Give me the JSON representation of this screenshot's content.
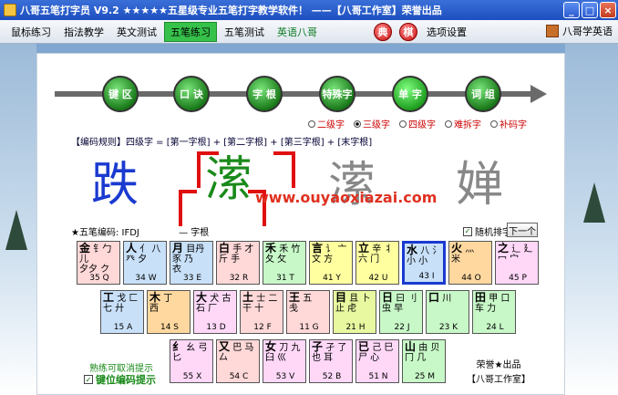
{
  "window": {
    "title": "八哥五笔打字员 V9.2  ★★★★★五星级专业五笔打字教学软件！ ——【八哥工作室】荣誉出品",
    "min": "_",
    "max": "□",
    "close": "×"
  },
  "menu": {
    "items": [
      "鼠标练习",
      "指法教学",
      "英文测试",
      "五笔练习",
      "五笔测试",
      "英语八哥"
    ],
    "round1": "典",
    "round2": "棋",
    "settings": "选项设置",
    "right": "八哥学英语"
  },
  "nav": [
    "键 区",
    "口 诀",
    "字 根",
    "特殊字",
    "单 字",
    "词 组"
  ],
  "radios": [
    "二级字",
    "三级字",
    "四级字",
    "难拆字",
    "补码字"
  ],
  "rule": "【编码规则】四级字 = [第一字根] + [第二字根] + [第三字根] + [末字根]",
  "chars": [
    "跌",
    "潆",
    "潆",
    "婵"
  ],
  "watermark": "www.ouyaoxiazai.com",
  "code_line": "★五笔编码: IFDJ",
  "code_mid": "— 字根",
  "random_label": "随机排字",
  "next_label": "下一个",
  "keys_row1": [
    {
      "main": "金",
      "roots": "钅勹 儿\n夕夕 ク",
      "code": "35 Q"
    },
    {
      "main": "人",
      "roots": "亻 八\n癶 夕",
      "code": "34 W"
    },
    {
      "main": "月",
      "roots": "目丹\n豕 乃\n衣",
      "code": "33 E"
    },
    {
      "main": "白",
      "roots": "手 才\n斤 手",
      "code": "32 R"
    },
    {
      "main": "禾",
      "roots": "禾 竹\n夂 攵",
      "code": "31 T"
    },
    {
      "main": "言",
      "roots": "讠 亠\n文 方",
      "code": "41 Y"
    },
    {
      "main": "立",
      "roots": "辛 丬\n六 门",
      "code": "42 U"
    },
    {
      "main": "水",
      "roots": "八 氵\n小 小",
      "code": "43 I"
    },
    {
      "main": "火",
      "roots": "灬\n米",
      "code": "44 O"
    },
    {
      "main": "之",
      "roots": "辶 廴\n冖 宀",
      "code": "45 P"
    }
  ],
  "keys_row2": [
    {
      "main": "工",
      "roots": "戈 匚\n七 廾",
      "code": "15 A"
    },
    {
      "main": "木",
      "roots": "丁\n西",
      "code": "14 S"
    },
    {
      "main": "大",
      "roots": "犬 古\n石 厂",
      "code": "13 D"
    },
    {
      "main": "土",
      "roots": "士 二\n干 十",
      "code": "12 F"
    },
    {
      "main": "王",
      "roots": "五\n戋",
      "code": "11 G"
    },
    {
      "main": "目",
      "roots": "且 卜\n止 虍",
      "code": "21 H"
    },
    {
      "main": "日",
      "roots": "曰 刂\n虫 早",
      "code": "22 J"
    },
    {
      "main": "口",
      "roots": "川",
      "code": "23 K"
    },
    {
      "main": "田",
      "roots": "甲 口\n车 力",
      "code": "24 L"
    }
  ],
  "keys_row3": [
    {
      "main": "纟",
      "roots": "幺 弓\n匕",
      "code": "55 X"
    },
    {
      "main": "又",
      "roots": "巴 马\n厶",
      "code": "54 C"
    },
    {
      "main": "女",
      "roots": "刀 九\n臼 巛",
      "code": "53 V"
    },
    {
      "main": "子",
      "roots": "孑 了\n也 耳",
      "code": "52 B"
    },
    {
      "main": "已",
      "roots": "己 巳\n尸 心",
      "code": "51 N"
    },
    {
      "main": "山",
      "roots": "由 贝\n冂 几",
      "code": "25 M"
    }
  ],
  "note1": "熟练可取消提示",
  "note2": "键位编码提示",
  "credit": "荣誉★出品 【八哥工作室】",
  "colors": {
    "row1": [
      "#ffd8d8",
      "#c8e0f8",
      "#c8e0f8",
      "#ffd8d8",
      "#c8f8c8",
      "#ffffa0",
      "#ffffa0",
      "#c8e0f8",
      "#ffd8a0",
      "#ffd8f8"
    ],
    "row2": [
      "#c8e0f8",
      "#ffd8a0",
      "#ffd8f8",
      "#ffd8d8",
      "#ffd8d8",
      "#e8f8a0",
      "#c8f8c8",
      "#c8f8c8",
      "#c8f8c8"
    ],
    "row3": [
      "#ffd8f8",
      "#ffd8d8",
      "#ffd8f8",
      "#ffd8f8",
      "#ffd8f8",
      "#c8f8c8"
    ]
  }
}
